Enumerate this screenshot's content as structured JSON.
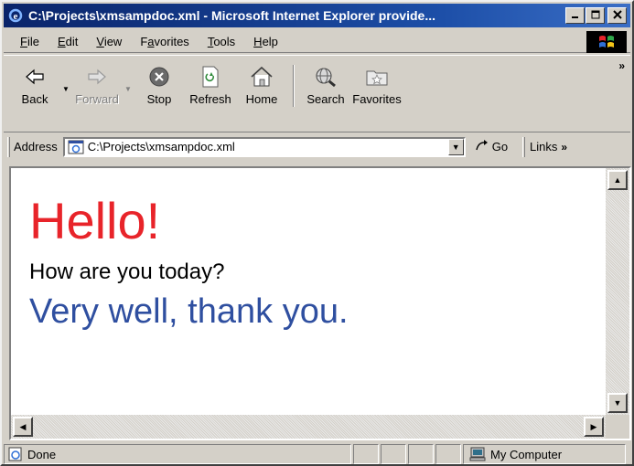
{
  "window": {
    "title": "C:\\Projects\\xmsampdoc.xml - Microsoft Internet Explorer provide...",
    "minimize_icon": "minimize-icon",
    "maximize_icon": "maximize-icon",
    "close_icon": "close-icon"
  },
  "menu": {
    "items": [
      {
        "label": "File",
        "accel": "F"
      },
      {
        "label": "Edit",
        "accel": "E"
      },
      {
        "label": "View",
        "accel": "V"
      },
      {
        "label": "Favorites",
        "accel": "a"
      },
      {
        "label": "Tools",
        "accel": "T"
      },
      {
        "label": "Help",
        "accel": "H"
      }
    ]
  },
  "toolbar": {
    "back": "Back",
    "forward": "Forward",
    "stop": "Stop",
    "refresh": "Refresh",
    "home": "Home",
    "search": "Search",
    "favorites": "Favorites",
    "more": "»"
  },
  "address": {
    "label": "Address",
    "value": "C:\\Projects\\xmsampdoc.xml",
    "go": "Go",
    "links": "Links",
    "links_more": "»"
  },
  "content": {
    "hello": "Hello!",
    "question": "How are you today?",
    "answer": "Very well, thank you."
  },
  "status": {
    "text": "Done",
    "zone": "My Computer"
  },
  "colors": {
    "hello": "#e8242a",
    "answer": "#2f4fa0",
    "titlebar": "#0a246a"
  }
}
